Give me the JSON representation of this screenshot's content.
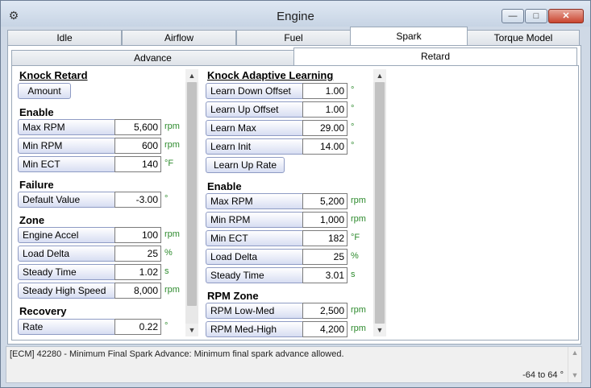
{
  "window": {
    "title": "Engine",
    "icon": "gauge-icon"
  },
  "top_tabs": [
    "Idle",
    "Airflow",
    "Fuel",
    "Spark",
    "Torque Model"
  ],
  "top_tab_active": "Spark",
  "sub_tabs": [
    "Advance",
    "Retard"
  ],
  "sub_tab_active": "Retard",
  "left": {
    "knock_retard_heading": "Knock Retard",
    "amount_button": "Amount",
    "enable_heading": "Enable",
    "enable_rows": [
      {
        "label": "Max RPM",
        "value": "5,600",
        "unit": "rpm"
      },
      {
        "label": "Min RPM",
        "value": "600",
        "unit": "rpm"
      },
      {
        "label": "Min ECT",
        "value": "140",
        "unit": "°F"
      }
    ],
    "failure_heading": "Failure",
    "failure_rows": [
      {
        "label": "Default Value",
        "value": "-3.00",
        "unit": "°"
      }
    ],
    "zone_heading": "Zone",
    "zone_rows": [
      {
        "label": "Engine Accel",
        "value": "100",
        "unit": "rpm"
      },
      {
        "label": "Load Delta",
        "value": "25",
        "unit": "%"
      },
      {
        "label": "Steady Time",
        "value": "1.02",
        "unit": "s"
      },
      {
        "label": "Steady High Speed",
        "value": "8,000",
        "unit": "rpm"
      }
    ],
    "recovery_heading": "Recovery",
    "recovery_rows": [
      {
        "label": "Rate",
        "value": "0.22",
        "unit": "°"
      }
    ]
  },
  "right": {
    "kal_heading": "Knock Adaptive Learning",
    "kal_rows": [
      {
        "label": "Learn Down Offset",
        "value": "1.00",
        "unit": "°"
      },
      {
        "label": "Learn Up Offset",
        "value": "1.00",
        "unit": "°"
      },
      {
        "label": "Learn Max",
        "value": "29.00",
        "unit": "°"
      },
      {
        "label": "Learn Init",
        "value": "14.00",
        "unit": "°"
      }
    ],
    "learn_up_rate_button": "Learn Up Rate",
    "enable_heading": "Enable",
    "enable_rows": [
      {
        "label": "Max RPM",
        "value": "5,200",
        "unit": "rpm"
      },
      {
        "label": "Min RPM",
        "value": "1,000",
        "unit": "rpm"
      },
      {
        "label": "Min ECT",
        "value": "182",
        "unit": "°F"
      },
      {
        "label": "Load Delta",
        "value": "25",
        "unit": "%"
      },
      {
        "label": "Steady Time",
        "value": "3.01",
        "unit": "s"
      }
    ],
    "rpm_zone_heading": "RPM Zone",
    "rpm_zone_rows": [
      {
        "label": "RPM Low-Med",
        "value": "2,500",
        "unit": "rpm"
      },
      {
        "label": "RPM Med-High",
        "value": "4,200",
        "unit": "rpm"
      }
    ]
  },
  "status": {
    "message": "[ECM] 42280 - Minimum Final Spark Advance: Minimum final spark advance allowed.",
    "range": "-64 to 64 °"
  },
  "colors": {
    "unit_text": "#2e8b2e",
    "label_bg": "#d7ddf2",
    "frame": "#cfd9e6"
  }
}
